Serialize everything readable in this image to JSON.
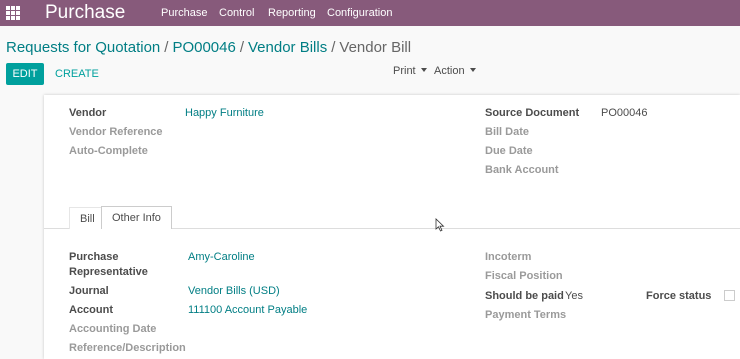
{
  "app": {
    "title": "Purchase"
  },
  "nav": {
    "items": [
      "Purchase",
      "Control",
      "Reporting",
      "Configuration"
    ]
  },
  "breadcrumb": {
    "items": [
      "Requests for Quotation",
      "PO00046",
      "Vendor Bills"
    ],
    "current": "Vendor Bill"
  },
  "controls": {
    "edit": "EDIT",
    "create": "CREATE",
    "print": "Print",
    "action": "Action"
  },
  "form": {
    "vendor_label": "Vendor",
    "vendor_value": "Happy Furniture",
    "vendor_ref_label": "Vendor Reference",
    "autocomplete_label": "Auto-Complete",
    "source_doc_label": "Source Document",
    "source_doc_value": "PO00046",
    "bill_date_label": "Bill Date",
    "due_date_label": "Due Date",
    "bank_account_label": "Bank Account"
  },
  "tabs": [
    "Bill",
    "Other Info"
  ],
  "other_info": {
    "purchase_rep_label_1": "Purchase",
    "purchase_rep_label_2": "Representative",
    "purchase_rep_value": "Amy-Caroline",
    "journal_label": "Journal",
    "journal_value": "Vendor Bills (USD)",
    "account_label": "Account",
    "account_value": "111100 Account Payable",
    "accounting_date_label": "Accounting Date",
    "reference_label": "Reference/Description",
    "incoterm_label": "Incoterm",
    "fiscal_position_label": "Fiscal Position",
    "should_be_paid_label": "Should be paid",
    "should_be_paid_value": "Yes",
    "force_status_label": "Force status",
    "payment_terms_label": "Payment Terms"
  },
  "colors": {
    "brand": "#875a7b",
    "accent": "#00a09d",
    "link": "#017e84"
  },
  "icons": {
    "apps": "apps-grid-icon",
    "caret": "caret-down-icon",
    "cursor": "mouse-cursor-icon"
  }
}
